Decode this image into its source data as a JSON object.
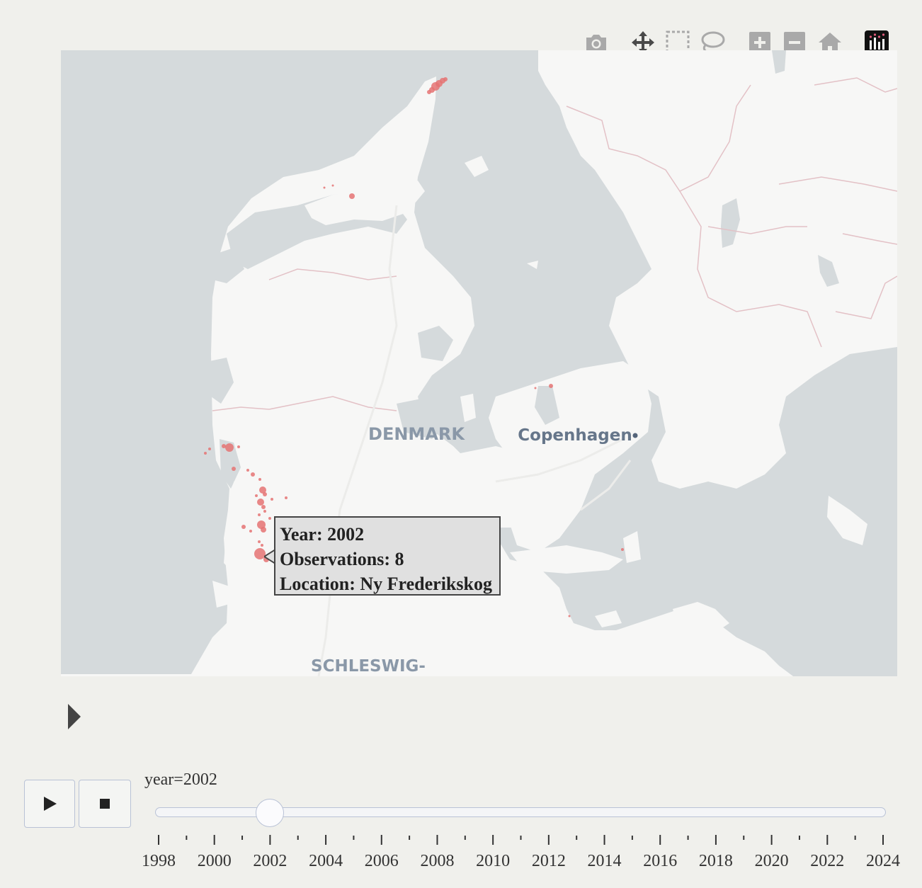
{
  "modebar": {
    "buttons": [
      {
        "name": "camera-icon",
        "title": "Download plot as a png"
      },
      {
        "name": "pan-icon",
        "title": "Pan"
      },
      {
        "name": "box-select-icon",
        "title": "Box Select"
      },
      {
        "name": "lasso-select-icon",
        "title": "Lasso Select"
      },
      {
        "name": "zoom-in-icon",
        "title": "Zoom in"
      },
      {
        "name": "zoom-out-icon",
        "title": "Zoom out"
      },
      {
        "name": "home-icon",
        "title": "Reset view"
      },
      {
        "name": "plotly-logo-icon",
        "title": "Produced with Plotly"
      }
    ]
  },
  "map": {
    "labels": {
      "country": "DENMARK",
      "city": "Copenhagen",
      "region": "SCHLESWIG-"
    },
    "marker_color": "#e57373"
  },
  "tooltip": {
    "year_line": "Year: 2002",
    "observations_line": "Observations: 8",
    "location_line": "Location: Ny Frederikskog"
  },
  "animation": {
    "slider_label": "year=2002",
    "current_year": 2002,
    "years": [
      1998,
      1999,
      2000,
      2001,
      2002,
      2003,
      2004,
      2005,
      2006,
      2007,
      2008,
      2009,
      2010,
      2011,
      2012,
      2013,
      2014,
      2015,
      2016,
      2017,
      2018,
      2019,
      2020,
      2021,
      2022,
      2023,
      2024
    ],
    "tick_labels": [
      "1998",
      "2000",
      "2002",
      "2004",
      "2006",
      "2008",
      "2010",
      "2012",
      "2014",
      "2016",
      "2018",
      "2020",
      "2022",
      "2024"
    ]
  }
}
